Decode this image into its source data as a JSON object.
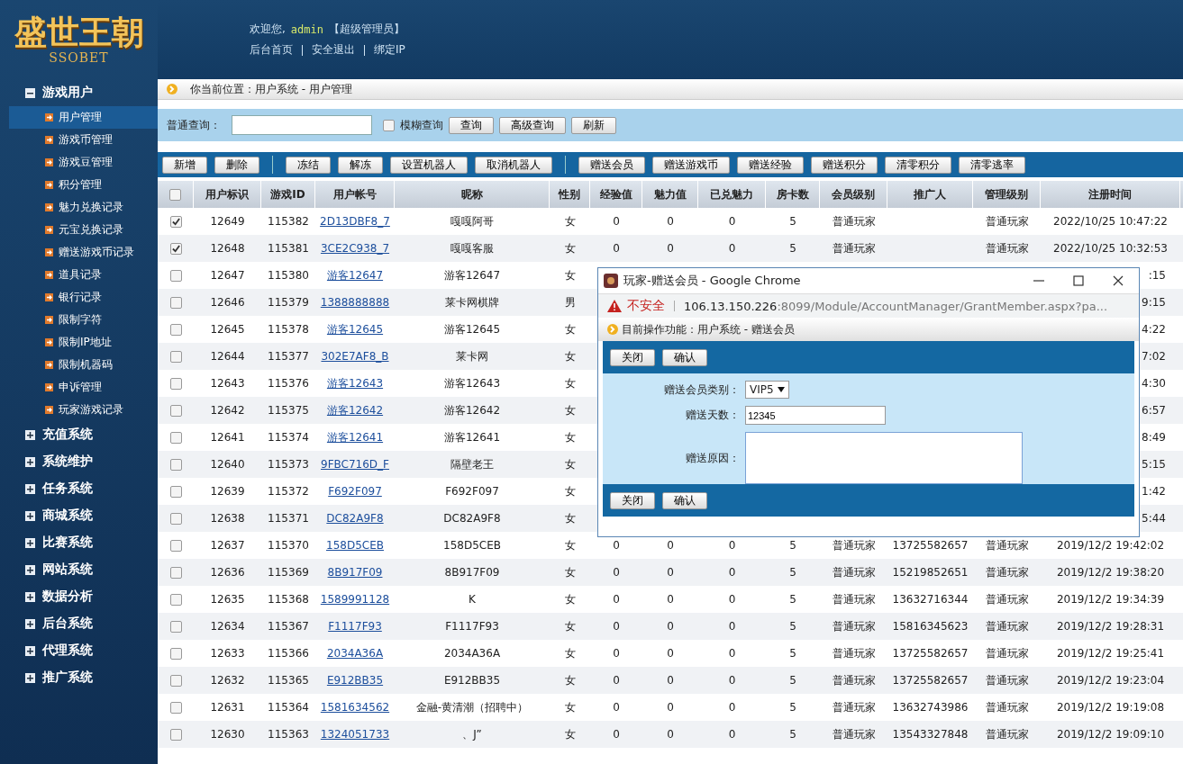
{
  "logo": {
    "title": "盛世王朝",
    "subtitle": "SSOBET"
  },
  "header": {
    "welcome": "欢迎您,",
    "user": "admin",
    "role": "【超级管理员】",
    "links": [
      "后台首页",
      "安全退出",
      "绑定IP"
    ]
  },
  "sidebar": [
    {
      "label": "游戏用户",
      "expanded": true,
      "children": [
        {
          "label": "用户管理",
          "selected": true
        },
        {
          "label": "游戏币管理",
          "selected": false
        },
        {
          "label": "游戏豆管理",
          "selected": false
        },
        {
          "label": "积分管理",
          "selected": false
        },
        {
          "label": "魅力兑换记录",
          "selected": false
        },
        {
          "label": "元宝兑换记录",
          "selected": false
        },
        {
          "label": "赠送游戏币记录",
          "selected": false
        },
        {
          "label": "道具记录",
          "selected": false
        },
        {
          "label": "银行记录",
          "selected": false
        },
        {
          "label": "限制字符",
          "selected": false
        },
        {
          "label": "限制IP地址",
          "selected": false
        },
        {
          "label": "限制机器码",
          "selected": false
        },
        {
          "label": "申诉管理",
          "selected": false
        },
        {
          "label": "玩家游戏记录",
          "selected": false
        }
      ]
    },
    {
      "label": "充值系统",
      "expanded": false
    },
    {
      "label": "系统维护",
      "expanded": false
    },
    {
      "label": "任务系统",
      "expanded": false
    },
    {
      "label": "商城系统",
      "expanded": false
    },
    {
      "label": "比赛系统",
      "expanded": false
    },
    {
      "label": "网站系统",
      "expanded": false
    },
    {
      "label": "数据分析",
      "expanded": false
    },
    {
      "label": "后台系统",
      "expanded": false
    },
    {
      "label": "代理系统",
      "expanded": false
    },
    {
      "label": "推广系统",
      "expanded": false
    }
  ],
  "breadcrumb": "你当前位置：用户系统 - 用户管理",
  "search": {
    "label": "普通查询：",
    "fuzzy": {
      "label": "模糊查询",
      "checked": false
    },
    "buttons": [
      "查询",
      "高级查询",
      "刷新"
    ]
  },
  "toolbar": [
    [
      "新增",
      "删除"
    ],
    [
      "冻结",
      "解冻",
      "设置机器人",
      "取消机器人"
    ],
    [
      "赠送会员",
      "赠送游戏币",
      "赠送经验",
      "赠送积分",
      "清零积分",
      "清零逃率"
    ]
  ],
  "table": {
    "select_all": {
      "checked": false
    },
    "columns": [
      "用户标识",
      "游戏ID",
      "用户帐号",
      "昵称",
      "性别",
      "经验值",
      "魅力值",
      "已兑魅力",
      "房卡数",
      "会员级别",
      "推广人",
      "管理级别",
      "注册时间"
    ],
    "rows": [
      {
        "kind": "full",
        "checked": true,
        "cells": [
          "12649",
          "115382",
          "2D13DBF8_7",
          "嘎嘎阿哥",
          "女",
          "0",
          "0",
          "0",
          "5",
          "普通玩家",
          "",
          "普通玩家",
          "2022/10/25 10:47:22"
        ]
      },
      {
        "kind": "full",
        "checked": true,
        "cells": [
          "12648",
          "115381",
          "3CE2C938_7",
          "嘎嘎客服",
          "女",
          "0",
          "0",
          "0",
          "5",
          "普通玩家",
          "",
          "普通玩家",
          "2022/10/25 10:32:53"
        ]
      },
      {
        "kind": "covered",
        "checked": false,
        "cells": [
          "12647",
          "115380",
          "游客12647",
          "游客12647",
          "女",
          "",
          "",
          "",
          "",
          "",
          "",
          "",
          ":15"
        ]
      },
      {
        "kind": "covered",
        "checked": false,
        "cells": [
          "12646",
          "115379",
          "1388888888",
          "莱卡网棋牌",
          "男",
          "",
          "",
          "",
          "",
          "",
          "",
          "",
          "9:15"
        ]
      },
      {
        "kind": "covered",
        "checked": false,
        "cells": [
          "12645",
          "115378",
          "游客12645",
          "游客12645",
          "女",
          "",
          "",
          "",
          "",
          "",
          "",
          "",
          "4:22"
        ]
      },
      {
        "kind": "covered",
        "checked": false,
        "cells": [
          "12644",
          "115377",
          "302E7AF8_B",
          "莱卡网",
          "女",
          "",
          "",
          "",
          "",
          "",
          "",
          "",
          "7:02"
        ]
      },
      {
        "kind": "covered",
        "checked": false,
        "cells": [
          "12643",
          "115376",
          "游客12643",
          "游客12643",
          "女",
          "",
          "",
          "",
          "",
          "",
          "",
          "",
          "4:30"
        ]
      },
      {
        "kind": "covered",
        "checked": false,
        "cells": [
          "12642",
          "115375",
          "游客12642",
          "游客12642",
          "女",
          "",
          "",
          "",
          "",
          "",
          "",
          "",
          "6:57"
        ]
      },
      {
        "kind": "covered",
        "checked": false,
        "cells": [
          "12641",
          "115374",
          "游客12641",
          "游客12641",
          "女",
          "",
          "",
          "",
          "",
          "",
          "",
          "",
          "8:49"
        ]
      },
      {
        "kind": "covered",
        "checked": false,
        "cells": [
          "12640",
          "115373",
          "9FBC716D_F",
          "隔壁老王",
          "女",
          "",
          "",
          "",
          "",
          "",
          "",
          "",
          "5:15"
        ]
      },
      {
        "kind": "covered",
        "checked": false,
        "cells": [
          "12639",
          "115372",
          "F692F097",
          "F692F097",
          "女",
          "",
          "",
          "",
          "",
          "",
          "",
          "",
          "1:42"
        ]
      },
      {
        "kind": "covered",
        "checked": false,
        "cells": [
          "12638",
          "115371",
          "DC82A9F8",
          "DC82A9F8",
          "女",
          "",
          "",
          "",
          "",
          "",
          "",
          "",
          "5:44"
        ]
      },
      {
        "kind": "full",
        "checked": false,
        "cells": [
          "12637",
          "115370",
          "158D5CEB",
          "158D5CEB",
          "女",
          "0",
          "0",
          "0",
          "5",
          "普通玩家",
          "13725582657",
          "普通玩家",
          "2019/12/2 19:42:02"
        ]
      },
      {
        "kind": "full",
        "checked": false,
        "cells": [
          "12636",
          "115369",
          "8B917F09",
          "8B917F09",
          "女",
          "0",
          "0",
          "0",
          "5",
          "普通玩家",
          "15219852651",
          "普通玩家",
          "2019/12/2 19:38:20"
        ]
      },
      {
        "kind": "full",
        "checked": false,
        "cells": [
          "12635",
          "115368",
          "1589991128",
          "K",
          "女",
          "0",
          "0",
          "0",
          "5",
          "普通玩家",
          "13632716344",
          "普通玩家",
          "2019/12/2 19:34:39"
        ]
      },
      {
        "kind": "full",
        "checked": false,
        "cells": [
          "12634",
          "115367",
          "F1117F93",
          "F1117F93",
          "女",
          "0",
          "0",
          "0",
          "5",
          "普通玩家",
          "15816345623",
          "普通玩家",
          "2019/12/2 19:28:31"
        ]
      },
      {
        "kind": "full",
        "checked": false,
        "cells": [
          "12633",
          "115366",
          "2034A36A",
          "2034A36A",
          "女",
          "0",
          "0",
          "0",
          "5",
          "普通玩家",
          "13725582657",
          "普通玩家",
          "2019/12/2 19:25:41"
        ]
      },
      {
        "kind": "full",
        "checked": false,
        "cells": [
          "12632",
          "115365",
          "E912BB35",
          "E912BB35",
          "女",
          "0",
          "0",
          "0",
          "5",
          "普通玩家",
          "13725582657",
          "普通玩家",
          "2019/12/2 19:23:04"
        ]
      },
      {
        "kind": "full",
        "checked": false,
        "cells": [
          "12631",
          "115364",
          "1581634562",
          "金融-黄清潮（招聘中）",
          "女",
          "0",
          "0",
          "0",
          "5",
          "普通玩家",
          "13632743986",
          "普通玩家",
          "2019/12/2 19:19:08"
        ]
      },
      {
        "kind": "full",
        "checked": false,
        "cells": [
          "12630",
          "115363",
          "1324051733",
          "、J”",
          "女",
          "0",
          "0",
          "0",
          "5",
          "普通玩家",
          "13543327848",
          "普通玩家",
          "2019/12/2 19:09:10"
        ]
      }
    ]
  },
  "popup": {
    "title": "玩家-赠送会员 - Google Chrome",
    "insecure": "不安全",
    "url_host": "106.13.150.226",
    "url_path": ":8099/Module/AccountManager/GrantMember.aspx?pa...",
    "breadcrumb": "目前操作功能：用户系统 - 赠送会员",
    "top_buttons": [
      "关闭",
      "确认"
    ],
    "fields": [
      {
        "kind": "select",
        "label": "赠送会员类别：",
        "value": "VIP5"
      },
      {
        "kind": "input",
        "label": "赠送天数：",
        "value": "12345"
      },
      {
        "kind": "textarea",
        "label": "赠送原因："
      }
    ],
    "bottom_buttons": [
      "关闭",
      "确认"
    ]
  }
}
